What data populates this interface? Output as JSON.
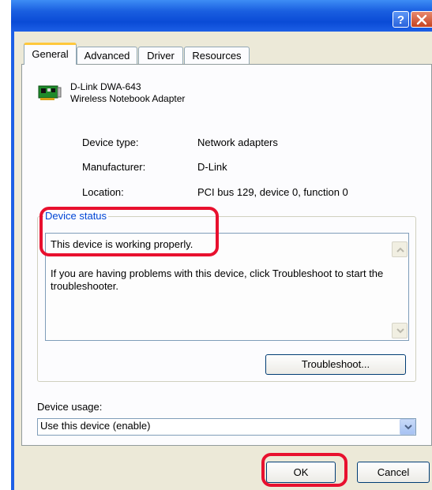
{
  "window": {
    "help_glyph": "?",
    "accent_color": "#1d5fe6"
  },
  "tabs": [
    "General",
    "Advanced",
    "Driver",
    "Resources"
  ],
  "device": {
    "name": "D-Link DWA-643",
    "subtitle": "Wireless Notebook Adapter",
    "icon": "network-card-icon"
  },
  "properties": [
    {
      "label": "Device type:",
      "value": "Network adapters"
    },
    {
      "label": "Manufacturer:",
      "value": "D-Link"
    },
    {
      "label": "Location:",
      "value": "PCI bus 129, device 0, function 0"
    }
  ],
  "device_status": {
    "legend": "Device status",
    "line1": "This device is working properly.",
    "line2": "If you are having problems with this device, click Troubleshoot to start the troubleshooter."
  },
  "buttons": {
    "troubleshoot": "Troubleshoot...",
    "ok": "OK",
    "cancel": "Cancel"
  },
  "device_usage": {
    "label": "Device usage:",
    "selected": "Use this device (enable)"
  },
  "annotation_color": "#e8102e"
}
